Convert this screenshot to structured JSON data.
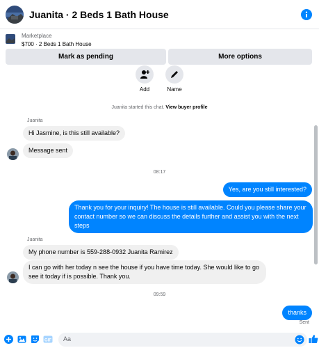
{
  "header": {
    "title": "Juanita · 2 Beds 1 Bath House",
    "info_icon": "info-icon"
  },
  "marketplace": {
    "label": "Marketplace",
    "listing": "$700 · 2 Beds 1 Bath House",
    "pending_button": "Mark as pending",
    "options_button": "More options"
  },
  "actions": [
    {
      "label": "Add",
      "icon": "add-user-icon"
    },
    {
      "label": "Name",
      "icon": "pencil-icon"
    }
  ],
  "chat": {
    "started_text": "Juanita started this chat.",
    "view_profile_link": "View buyer profile",
    "sender_1": "Juanita",
    "msg_1": "Hi Jasmine, is this still available?",
    "msg_2": "Message sent",
    "time_1": "08:17",
    "msg_3": "Yes, are you still interested?",
    "msg_4": "Thank you for your inquiry! The house is still available. Could you please share your contact number so we can discuss the details further and assist you with the next steps",
    "sender_2": "Juanita",
    "msg_5": "My phone number is 559-288-0932 Juanita Ramirez",
    "msg_6": "I can go with her today n see the house if you have time today. She would like to go see it today if is possible.  Thank you.",
    "time_2": "09:59",
    "msg_7": "thanks",
    "status": "Sent"
  },
  "composer": {
    "placeholder": "Aa"
  },
  "colors": {
    "accent": "#0084ff",
    "incoming_bubble": "#f0f0f0",
    "button_bg": "#e4e6eb"
  }
}
